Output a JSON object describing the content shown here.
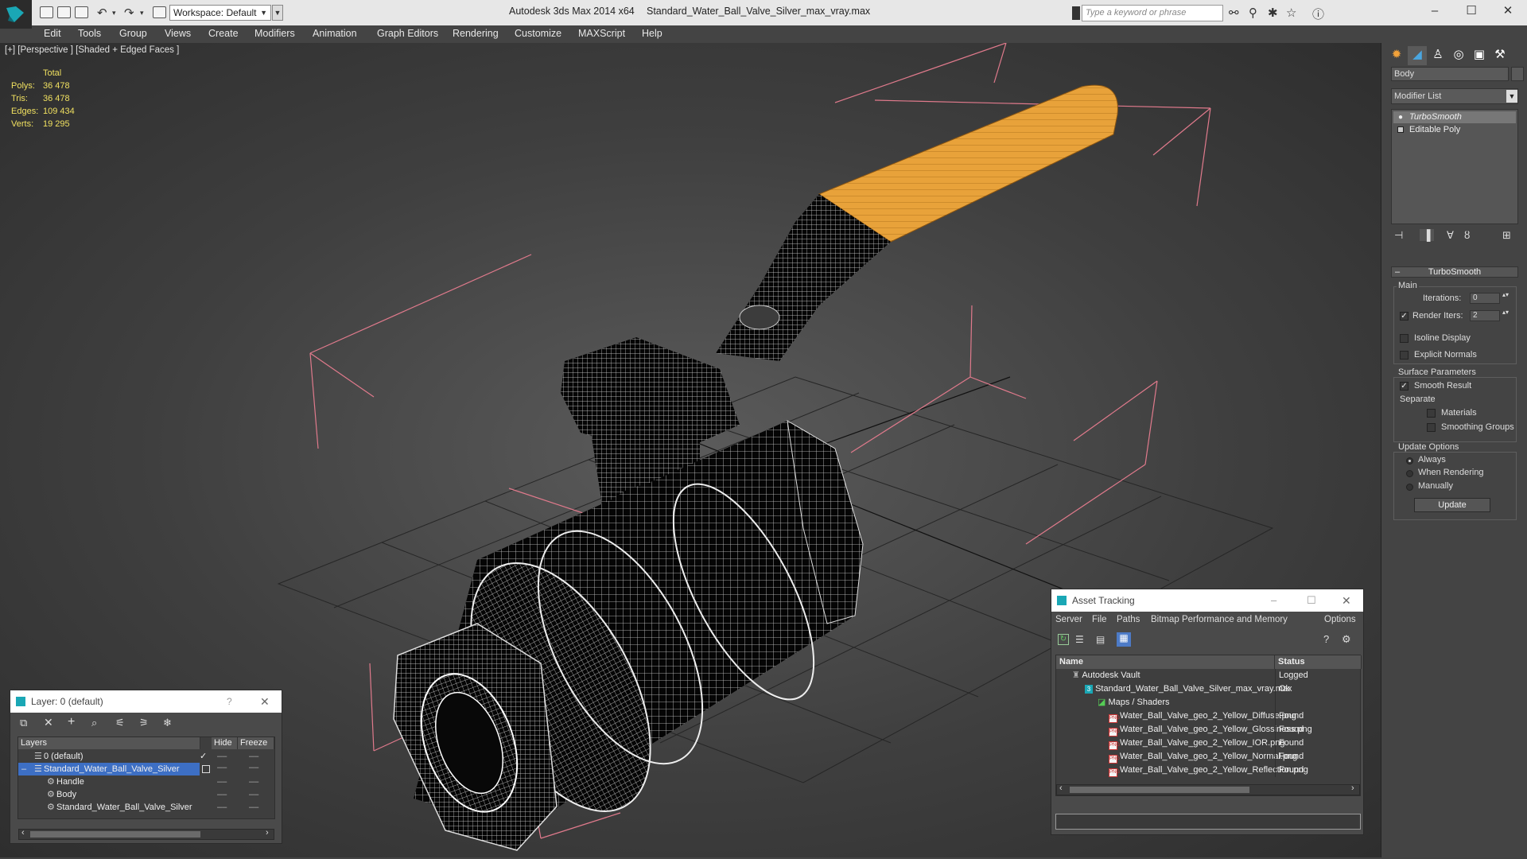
{
  "titlebar": {
    "workspace": "Workspace: Default",
    "app_title": "Autodesk 3ds Max  2014 x64",
    "file_title": "Standard_Water_Ball_Valve_Silver_max_vray.max",
    "search_placeholder": "Type a keyword or phrase"
  },
  "menu": [
    "Edit",
    "Tools",
    "Group",
    "Views",
    "Create",
    "Modifiers",
    "Animation",
    "Graph Editors",
    "Rendering",
    "Customize",
    "MAXScript",
    "Help"
  ],
  "viewport": {
    "label": "[+] [Perspective ] [Shaded + Edged Faces ]",
    "stats": {
      "header": "Total",
      "rows": [
        {
          "label": "Polys:",
          "value": "36 478"
        },
        {
          "label": "Tris:",
          "value": "36 478"
        },
        {
          "label": "Edges:",
          "value": "109 434"
        },
        {
          "label": "Verts:",
          "value": "19 295"
        }
      ]
    }
  },
  "command_panel": {
    "object_name": "Body",
    "modifier_list": "Modifier List",
    "stack": [
      "TurboSmooth",
      "Editable Poly"
    ],
    "rollout_title": "TurboSmooth",
    "main_group": "Main",
    "iterations_label": "Iterations:",
    "iterations_value": "0",
    "render_iters_label": "Render Iters:",
    "render_iters_value": "2",
    "isoline_display": "Isoline Display",
    "explicit_normals": "Explicit Normals",
    "surface_params": "Surface Parameters",
    "smooth_result": "Smooth Result",
    "separate": "Separate",
    "materials": "Materials",
    "smoothing_groups": "Smoothing Groups",
    "update_options": "Update Options",
    "always": "Always",
    "when_rendering": "When Rendering",
    "manually": "Manually",
    "update_button": "Update"
  },
  "asset_tracking": {
    "title": "Asset Tracking",
    "menu": [
      "Server",
      "File",
      "Paths",
      "Bitmap Performance and Memory",
      "Options"
    ],
    "columns": {
      "name": "Name",
      "status": "Status"
    },
    "rows": [
      {
        "name": "Autodesk Vault",
        "status": "Logged"
      },
      {
        "name": "Standard_Water_Ball_Valve_Silver_max_vray.max",
        "status": "Ok"
      },
      {
        "name": "Maps / Shaders",
        "status": ""
      },
      {
        "name": "Water_Ball_Valve_geo_2_Yellow_Diffuse.png",
        "status": "Found"
      },
      {
        "name": "Water_Ball_Valve_geo_2_Yellow_Glossiness.png",
        "status": "Found"
      },
      {
        "name": "Water_Ball_Valve_geo_2_Yellow_IOR.png",
        "status": "Found"
      },
      {
        "name": "Water_Ball_Valve_geo_2_Yellow_Normal.png",
        "status": "Found"
      },
      {
        "name": "Water_Ball_Valve_geo_2_Yellow_Reflection.png",
        "status": "Found"
      }
    ]
  },
  "layer_dialog": {
    "title": "Layer: 0 (default)",
    "help": "?",
    "columns": {
      "layers": "Layers",
      "hide": "Hide",
      "freeze": "Freeze"
    },
    "rows": [
      {
        "name": "0 (default)"
      },
      {
        "name": "Standard_Water_Ball_Valve_Silver"
      },
      {
        "name": "Handle"
      },
      {
        "name": "Body"
      },
      {
        "name": "Standard_Water_Ball_Valve_Silver"
      }
    ]
  },
  "colors": {
    "accent": "#3d6fc4",
    "handle": "#e8a23a",
    "bbox": "#e07a8c",
    "stats": "#f0e060"
  }
}
